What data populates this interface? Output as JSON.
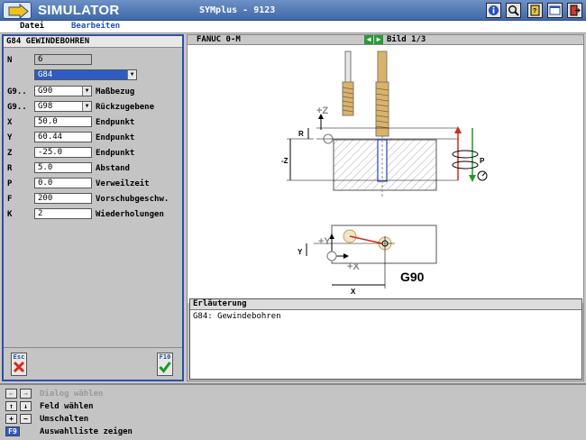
{
  "app": {
    "title": "SIMULATOR",
    "subtitle": "SYMplus - 9123"
  },
  "menu": {
    "datei": "Datei",
    "bearbeiten": "Bearbeiten"
  },
  "left": {
    "header": "G84 GEWINDEBOHREN",
    "n_label": "N",
    "n_value": "6",
    "cycle_select": "G84",
    "rows": [
      {
        "label": "G9..",
        "value": "G90",
        "desc": "Maßbezug"
      },
      {
        "label": "G9..",
        "value": "G98",
        "desc": "Rückzugebene"
      },
      {
        "label": "X",
        "value": "50.0",
        "desc": "Endpunkt"
      },
      {
        "label": "Y",
        "value": "60.44",
        "desc": "Endpunkt"
      },
      {
        "label": "Z",
        "value": "-25.0",
        "desc": "Endpunkt"
      },
      {
        "label": "R",
        "value": "5.0",
        "desc": "Abstand"
      },
      {
        "label": "P",
        "value": "0.0",
        "desc": "Verweilzeit"
      },
      {
        "label": "F",
        "value": "200",
        "desc": "Vorschubgeschw."
      },
      {
        "label": "K",
        "value": "2",
        "desc": "Wiederholungen"
      }
    ],
    "esc_label": "Esc",
    "f10_label": "F10"
  },
  "right": {
    "control": "FANUC 0-M",
    "bild": "Bild 1/3",
    "graphic": {
      "z_plus": "+Z",
      "r": "R",
      "minus_z": "-Z",
      "p": "P",
      "y_plus": "+Y",
      "y": "Y",
      "x_plus": "+X",
      "x": "X",
      "g90": "G90"
    },
    "explain_title": "Erläuterung",
    "explain_text": "G84: Gewindebohren"
  },
  "help": [
    {
      "keys": [
        "←",
        "→"
      ],
      "text": "Dialog wählen",
      "disabled": true
    },
    {
      "keys": [
        "↑",
        "↓"
      ],
      "text": "Feld wählen",
      "disabled": false
    },
    {
      "keys": [
        "+",
        "−"
      ],
      "text": "Umschalten",
      "disabled": false
    },
    {
      "keys": [
        "F9"
      ],
      "text": "Auswahlliste zeigen",
      "disabled": false
    }
  ]
}
